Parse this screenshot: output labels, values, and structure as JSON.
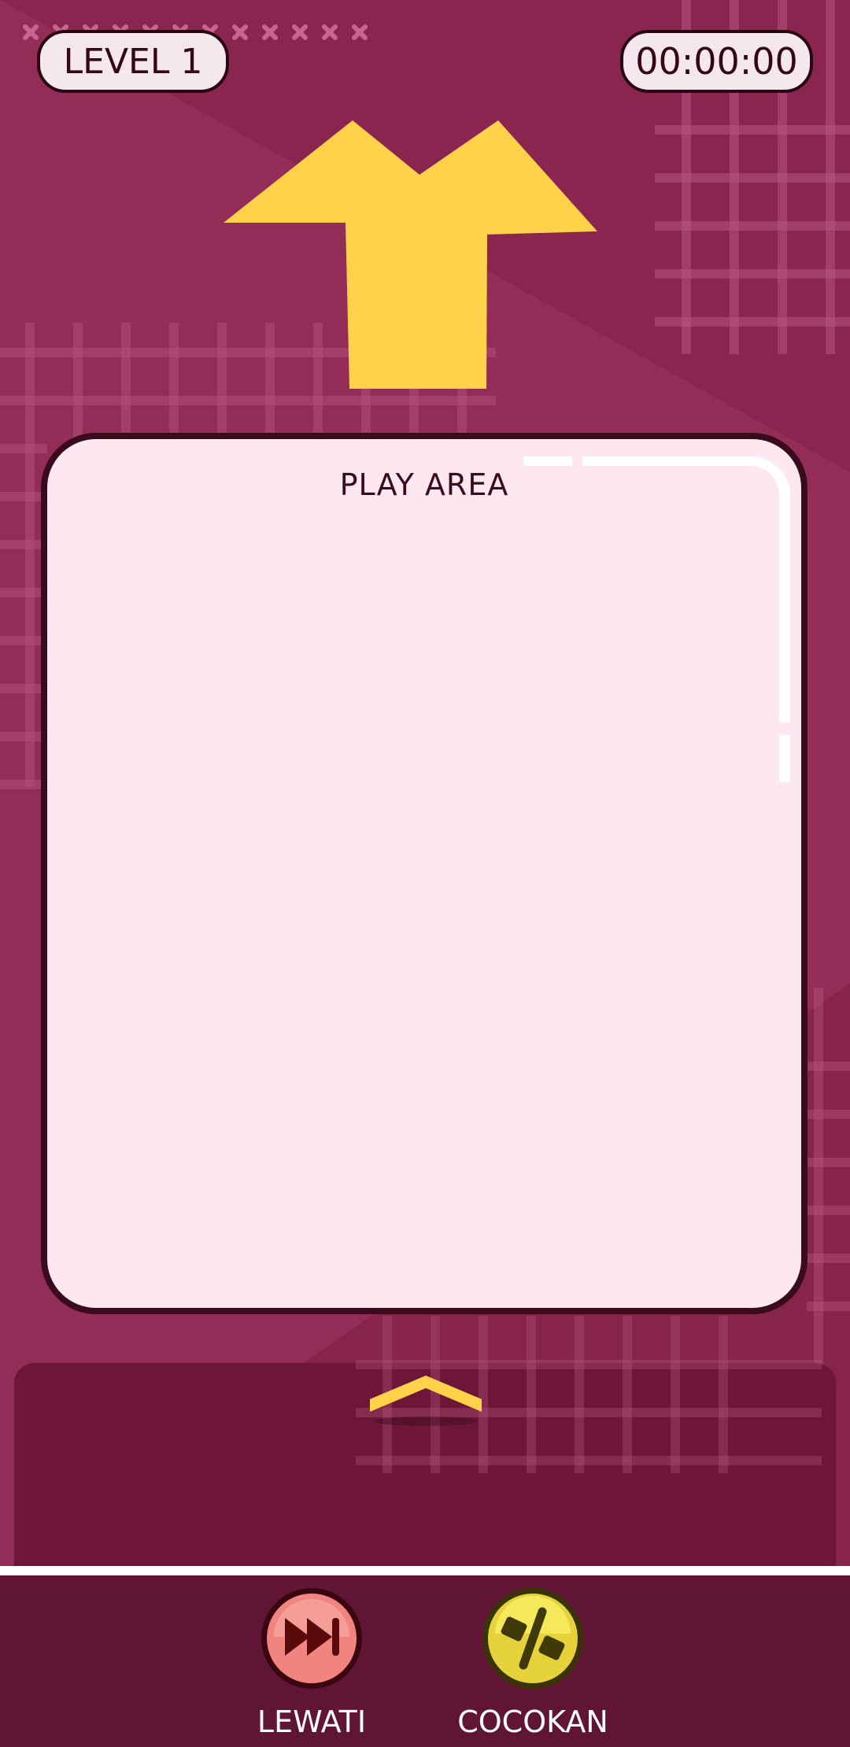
{
  "hud": {
    "level_label": "LEVEL 1",
    "timer": "00:00:00"
  },
  "target_shape": {
    "icon": "arrow-shape-icon",
    "color": "#ffd24a"
  },
  "play_area": {
    "title": "PLAY AREA",
    "background": "#fde8f1"
  },
  "tray": {
    "handle_icon": "chevron-up-icon"
  },
  "buttons": {
    "skip": {
      "label": "LEWATI",
      "icon": "skip-forward-icon",
      "color": "#f2847f"
    },
    "match": {
      "label": "COCOKAN",
      "icon": "percent-icon",
      "color": "#f2e048"
    }
  },
  "colors": {
    "background": "#8b2750",
    "bottom_bar": "#611535",
    "tray": "#6d1638"
  }
}
